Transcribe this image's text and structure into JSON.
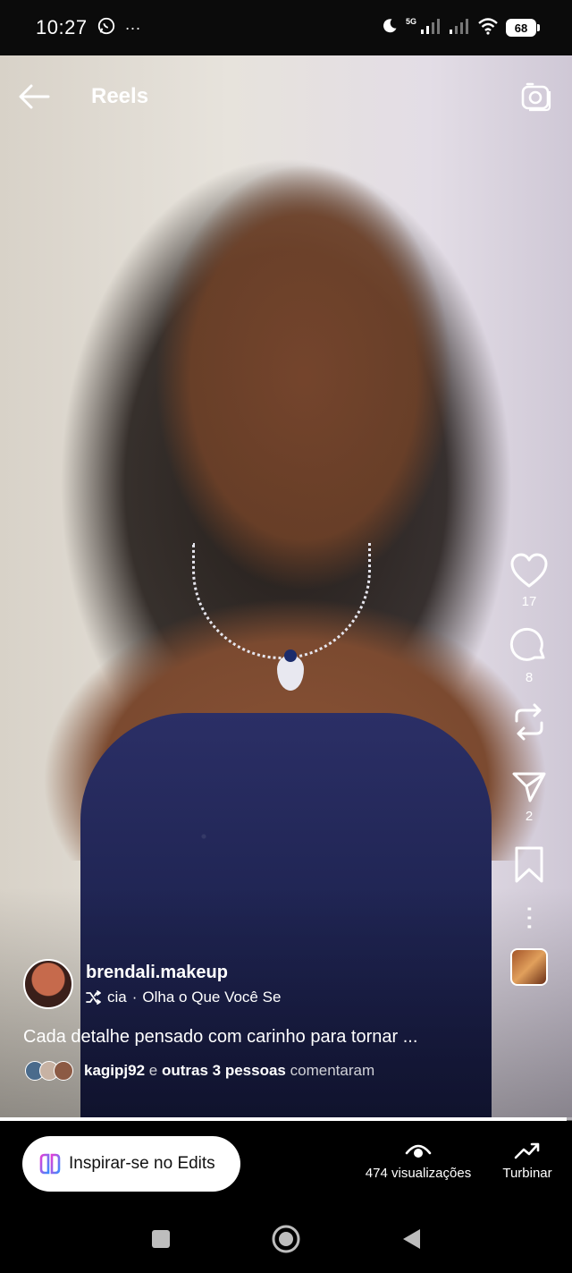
{
  "status_bar": {
    "time": "10:27",
    "more": "···",
    "network": "5G",
    "battery": "68"
  },
  "header": {
    "title": "Reels"
  },
  "actions": {
    "likes": "17",
    "comments": "8",
    "shares": "2"
  },
  "post": {
    "username": "brendali.makeup",
    "audio_artist": "cia",
    "audio_separator": "·",
    "audio_title": "Olha o Que Você Se",
    "caption": "Cada detalhe pensado com carinho para tornar ...",
    "commenter": "kagipj92",
    "comment_connector": "e",
    "comment_others": "outras 3 pessoas",
    "comment_verb": "comentaram"
  },
  "progress": {
    "fraction": 0.99
  },
  "bottom_bar": {
    "edits_label": "Inspirar-se no Edits",
    "views_label": "474 visualizações",
    "boost_label": "Turbinar"
  },
  "colors": {
    "dress": "#1f2452",
    "edits_gradient_start": "#e23fd8",
    "edits_gradient_end": "#3b8cff"
  }
}
